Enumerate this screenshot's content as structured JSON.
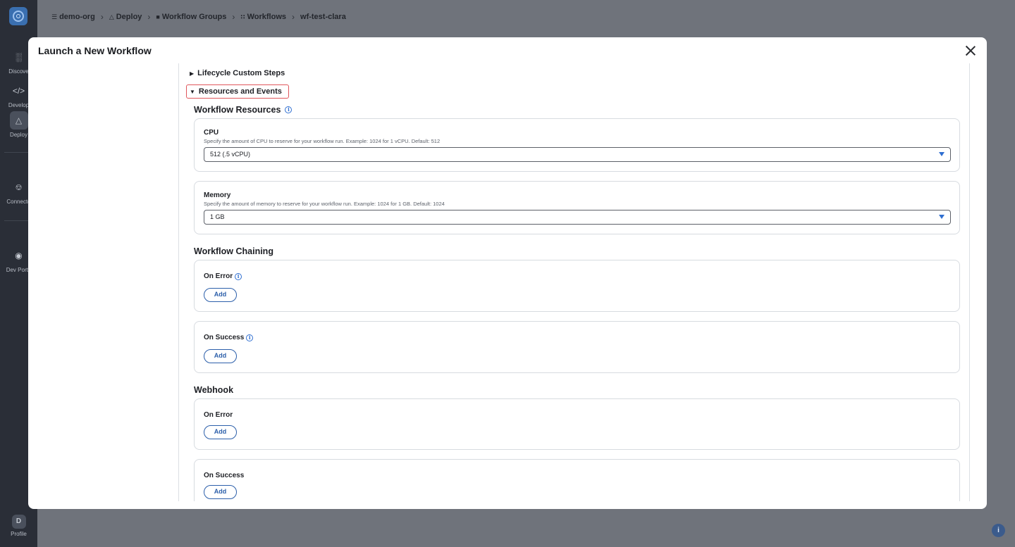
{
  "sidebar": {
    "items": [
      {
        "label": "Discove",
        "icon": "bar-chart-icon"
      },
      {
        "label": "Develop",
        "icon": "code-icon"
      },
      {
        "label": "Deploy",
        "icon": "deploy-icon"
      },
      {
        "label": "Connecto",
        "icon": "plug-icon"
      },
      {
        "label": "Dev Porta",
        "icon": "portal-icon"
      },
      {
        "label": "Profile",
        "icon": "profile-icon",
        "badge": "D"
      }
    ]
  },
  "breadcrumb": {
    "items": [
      {
        "label": "demo-org",
        "icon": "org-icon"
      },
      {
        "label": "Deploy",
        "icon": "deploy-icon"
      },
      {
        "label": "Workflow Groups",
        "icon": "folder-icon"
      },
      {
        "label": "Workflows",
        "icon": "grid-icon"
      },
      {
        "label": "wf-test-clara"
      }
    ]
  },
  "modal": {
    "title": "Launch a New Workflow",
    "lifecycle_label": "Lifecycle Custom Steps",
    "resources_label": "Resources and Events",
    "workflow_resources": {
      "title": "Workflow Resources",
      "cpu": {
        "label": "CPU",
        "description": "Specify the amount of CPU to reserve for your workflow run. Example: 1024 for 1 vCPU. Default: 512",
        "value": "512 (.5 vCPU)"
      },
      "memory": {
        "label": "Memory",
        "description": "Specify the amount of memory to reserve for your workflow run. Example: 1024 for 1 GB. Default: 1024",
        "value": "1 GB"
      }
    },
    "workflow_chaining": {
      "title": "Workflow Chaining",
      "on_error": "On Error",
      "on_success": "On Success",
      "add_label": "Add"
    },
    "webhook": {
      "title": "Webhook",
      "on_error": "On Error",
      "on_success": "On Success",
      "add_label": "Add"
    }
  },
  "colors": {
    "accent": "#2f6fd1",
    "highlight": "#e0565b",
    "sidebar": "#2a2e37"
  }
}
